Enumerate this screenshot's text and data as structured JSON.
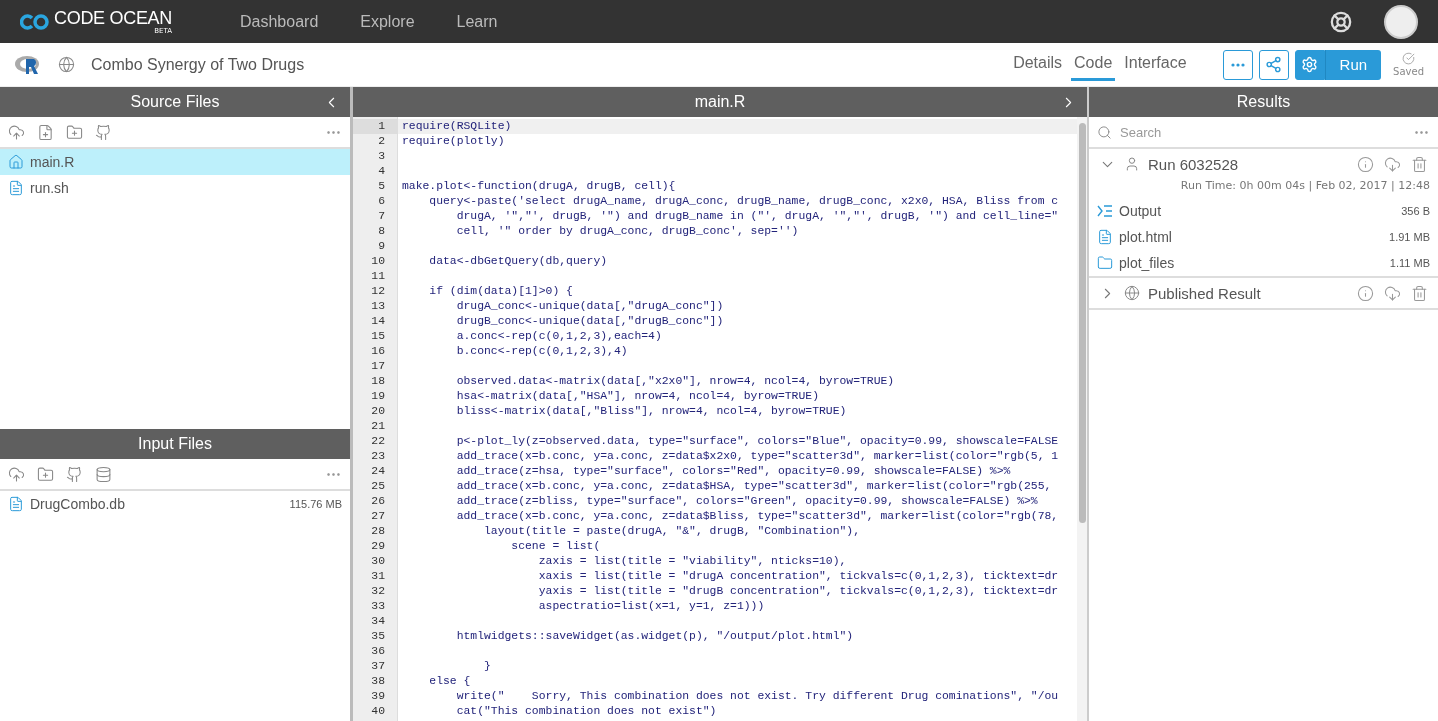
{
  "topbar": {
    "logo": "CODE OCEAN",
    "logo_badge": "BETA",
    "nav": [
      {
        "label": "Dashboard"
      },
      {
        "label": "Explore"
      },
      {
        "label": "Learn"
      }
    ]
  },
  "capsule": {
    "title": "Combo Synergy of Two Drugs",
    "tabs": [
      {
        "label": "Details",
        "selected": false
      },
      {
        "label": "Code",
        "selected": true
      },
      {
        "label": "Interface",
        "selected": false
      }
    ],
    "run_button": "Run",
    "saved": "Saved"
  },
  "source_files": {
    "title": "Source Files",
    "files": [
      {
        "name": "main.R",
        "kind": "home",
        "selected": true
      },
      {
        "name": "run.sh",
        "kind": "file",
        "selected": false
      }
    ]
  },
  "input_files": {
    "title": "Input Files",
    "files": [
      {
        "name": "DrugCombo.db",
        "size": "115.76 MB"
      }
    ]
  },
  "editor": {
    "title": "main.R",
    "lines": [
      {
        "number": "1",
        "text": "require(RSQLite)"
      },
      {
        "number": "2",
        "text": "require(plotly)"
      },
      {
        "number": "3"
      },
      {
        "number": "4"
      },
      {
        "number": "5",
        "text": "make.plot<-function(drugA, drugB, cell){"
      },
      {
        "number": "6",
        "text": "    query<-paste('select drugA_name, drugA_conc, drugB_name, drugB_conc, x2x0, HSA, Bliss from c"
      },
      {
        "number": "7",
        "text": "        drugA, '\",\"', drugB, '\") and drugB_name in (\"', drugA, '\",\"', drugB, '\") and cell_line=\""
      },
      {
        "number": "8",
        "text": "        cell, '\" order by drugA_conc, drugB_conc', sep='')"
      },
      {
        "number": "9"
      },
      {
        "number": "10",
        "text": "    data<-dbGetQuery(db,query)"
      },
      {
        "number": "11"
      },
      {
        "number": "12",
        "text": "    if (dim(data)[1]>0) {"
      },
      {
        "number": "13",
        "text": "        drugA_conc<-unique(data[,\"drugA_conc\"])"
      },
      {
        "number": "14",
        "text": "        drugB_conc<-unique(data[,\"drugB_conc\"])"
      },
      {
        "number": "15",
        "text": "        a.conc<-rep(c(0,1,2,3),each=4)"
      },
      {
        "number": "16",
        "text": "        b.conc<-rep(c(0,1,2,3),4)"
      },
      {
        "number": "17"
      },
      {
        "number": "18",
        "text": "        observed.data<-matrix(data[,\"x2x0\"], nrow=4, ncol=4, byrow=TRUE)"
      },
      {
        "number": "19",
        "text": "        hsa<-matrix(data[,\"HSA\"], nrow=4, ncol=4, byrow=TRUE)"
      },
      {
        "number": "20",
        "text": "        bliss<-matrix(data[,\"Bliss\"], nrow=4, ncol=4, byrow=TRUE)"
      },
      {
        "number": "21"
      },
      {
        "number": "22",
        "text": "        p<-plot_ly(z=observed.data, type=\"surface\", colors=\"Blue\", opacity=0.99, showscale=FALSE"
      },
      {
        "number": "23",
        "text": "        add_trace(x=b.conc, y=a.conc, z=data$x2x0, type=\"scatter3d\", marker=list(color=\"rgb(5, 1"
      },
      {
        "number": "24",
        "text": "        add_trace(z=hsa, type=\"surface\", colors=\"Red\", opacity=0.99, showscale=FALSE) %>%"
      },
      {
        "number": "25",
        "text": "        add_trace(x=b.conc, y=a.conc, z=data$HSA, type=\"scatter3d\", marker=list(color=\"rgb(255,"
      },
      {
        "number": "26",
        "text": "        add_trace(z=bliss, type=\"surface\", colors=\"Green\", opacity=0.99, showscale=FALSE) %>%"
      },
      {
        "number": "27",
        "text": "        add_trace(x=b.conc, y=a.conc, z=data$Bliss, type=\"scatter3d\", marker=list(color=\"rgb(78,"
      },
      {
        "number": "28",
        "text": "            layout(title = paste(drugA, \"&\", drugB, \"Combination\"),"
      },
      {
        "number": "29",
        "text": "                scene = list("
      },
      {
        "number": "30",
        "text": "                    zaxis = list(title = \"viability\", nticks=10),"
      },
      {
        "number": "31",
        "text": "                    xaxis = list(title = \"drugA concentration\", tickvals=c(0,1,2,3), ticktext=dr"
      },
      {
        "number": "32",
        "text": "                    yaxis = list(title = \"drugB concentration\", tickvals=c(0,1,2,3), ticktext=dr"
      },
      {
        "number": "33",
        "text": "                    aspectratio=list(x=1, y=1, z=1)))"
      },
      {
        "number": "34"
      },
      {
        "number": "35",
        "text": "        htmlwidgets::saveWidget(as.widget(p), \"/output/plot.html\")"
      },
      {
        "number": "36"
      },
      {
        "number": "37",
        "text": "            }"
      },
      {
        "number": "38",
        "text": "    else {"
      },
      {
        "number": "39",
        "text": "        write(\"    Sorry, This combination does not exist. Try different Drug cominations\", \"/ou"
      },
      {
        "number": "40",
        "text": "        cat(\"This combination does not exist\")"
      }
    ]
  },
  "results": {
    "title": "Results",
    "search_placeholder": "Search",
    "runs": [
      {
        "name": "Run 6032528",
        "expanded": true,
        "meta": "Run Time: 0h 00m 04s | Feb 02, 2017 | 12:48",
        "files": [
          {
            "name": "Output",
            "kind": "output",
            "size": "356 B"
          },
          {
            "name": "plot.html",
            "kind": "file",
            "size": "1.91 MB"
          },
          {
            "name": "plot_files",
            "kind": "folder",
            "size": "1.11 MB"
          }
        ]
      },
      {
        "name": "Published Result",
        "expanded": false
      }
    ]
  }
}
